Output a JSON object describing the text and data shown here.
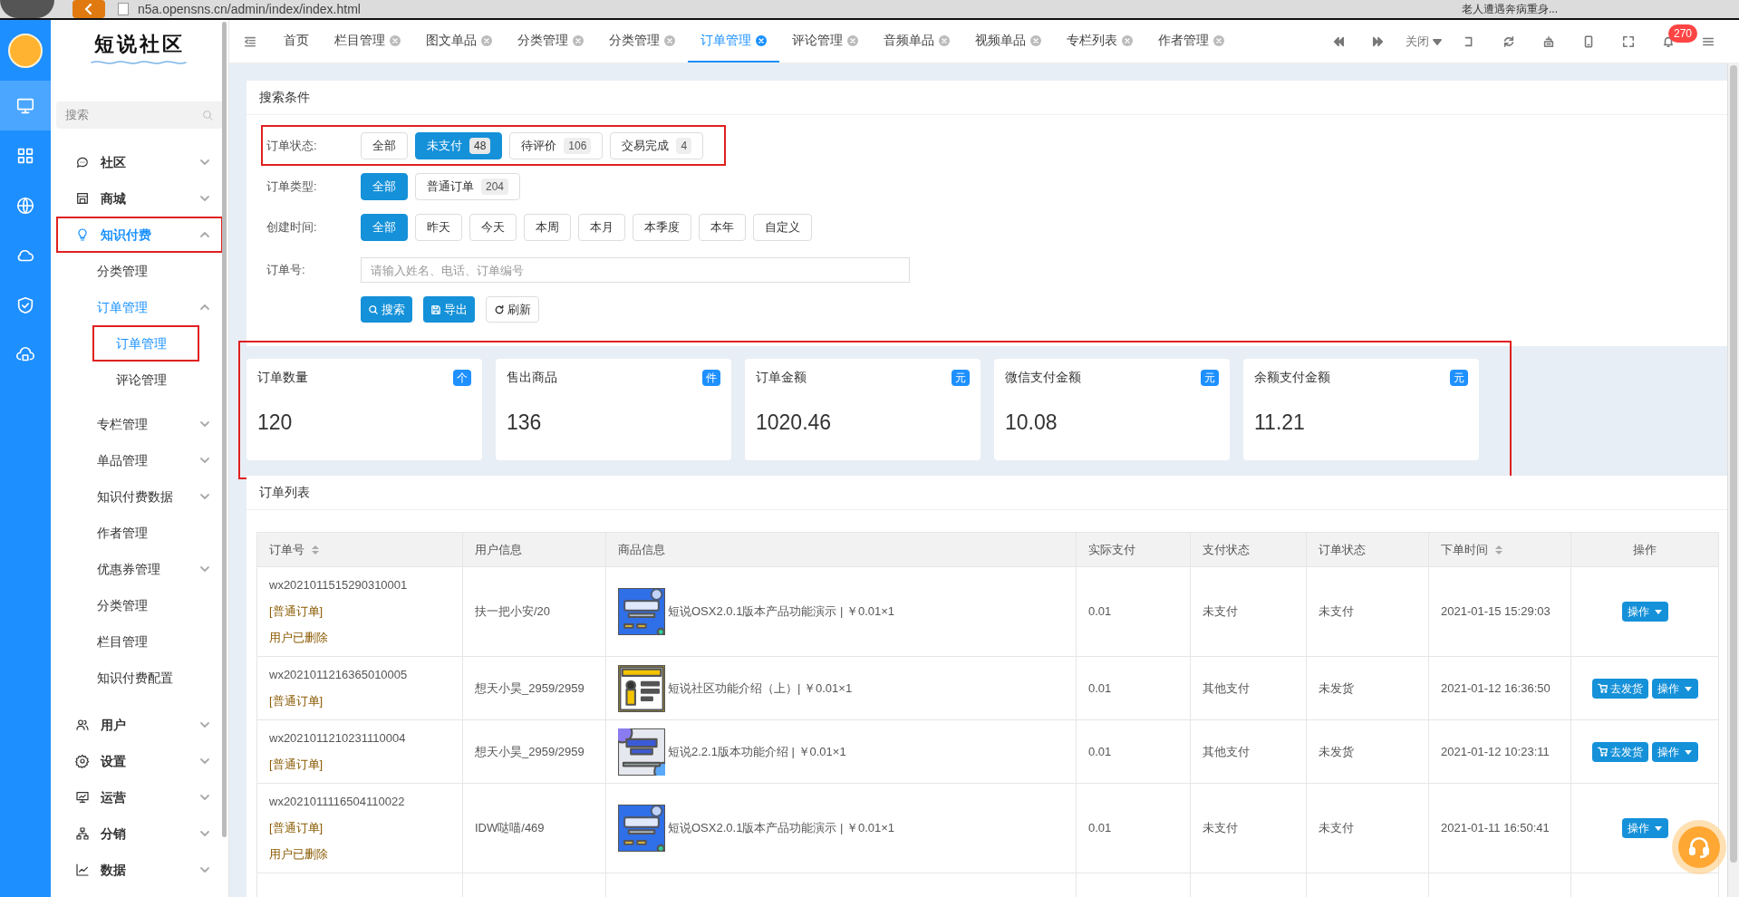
{
  "browser": {
    "url": "n5a.opensns.cn/admin/index/index.html",
    "news": "老人遭遇奔病重身..."
  },
  "rail": [
    {
      "selected": true
    },
    {
      "selected": false
    },
    {
      "selected": false
    },
    {
      "selected": false
    },
    {
      "selected": false
    },
    {
      "selected": false
    }
  ],
  "sidebar": {
    "logo": "短说社区",
    "search_placeholder": "搜索",
    "items": [
      {
        "label": "社区",
        "expanded": false,
        "selected": false,
        "marked": false
      },
      {
        "label": "商城",
        "expanded": false,
        "selected": false,
        "marked": false
      },
      {
        "label": "知识付费",
        "expanded": true,
        "selected": true,
        "marked": true,
        "children": [
          {
            "label": "分类管理",
            "selected": false,
            "marked": false
          },
          {
            "label": "订单管理",
            "expanded": true,
            "selected": true,
            "marked": false,
            "children": [
              {
                "label": "订单管理",
                "selected": true,
                "marked": true
              },
              {
                "label": "评论管理",
                "selected": false,
                "marked": false
              }
            ]
          },
          {
            "label": "专栏管理",
            "expanded": false,
            "selected": false,
            "marked": false
          },
          {
            "label": "单品管理",
            "expanded": false,
            "selected": false,
            "marked": false
          },
          {
            "label": "知识付费数据",
            "expanded": false,
            "selected": false,
            "marked": false
          },
          {
            "label": "作者管理",
            "selected": false,
            "marked": false
          },
          {
            "label": "优惠券管理",
            "expanded": false,
            "selected": false,
            "marked": false
          },
          {
            "label": "分类管理",
            "selected": false,
            "marked": false
          },
          {
            "label": "栏目管理",
            "selected": false,
            "marked": false
          },
          {
            "label": "知识付费配置",
            "selected": false,
            "marked": false
          }
        ]
      },
      {
        "label": "用户",
        "expanded": false,
        "selected": false,
        "marked": false
      },
      {
        "label": "设置",
        "expanded": false,
        "selected": false,
        "marked": false
      },
      {
        "label": "运营",
        "expanded": false,
        "selected": false,
        "marked": false
      },
      {
        "label": "分销",
        "expanded": false,
        "selected": false,
        "marked": false
      },
      {
        "label": "数据",
        "expanded": false,
        "selected": false,
        "marked": false
      }
    ]
  },
  "tabs": [
    {
      "label": "首页",
      "closable": false,
      "selected": false
    },
    {
      "label": "栏目管理",
      "closable": true,
      "selected": false
    },
    {
      "label": "图文单品",
      "closable": true,
      "selected": false
    },
    {
      "label": "分类管理",
      "closable": true,
      "selected": false
    },
    {
      "label": "分类管理",
      "closable": true,
      "selected": false
    },
    {
      "label": "订单管理",
      "closable": true,
      "selected": true
    },
    {
      "label": "评论管理",
      "closable": true,
      "selected": false
    },
    {
      "label": "音频单品",
      "closable": true,
      "selected": false
    },
    {
      "label": "视频单品",
      "closable": true,
      "selected": false
    },
    {
      "label": "专栏列表",
      "closable": true,
      "selected": false
    },
    {
      "label": "作者管理",
      "closable": true,
      "selected": false
    }
  ],
  "toolbar": {
    "close_menu": "关闭",
    "notifications": "270"
  },
  "search": {
    "title": "搜索条件",
    "filters": [
      {
        "label": "订单状态:",
        "marked": true,
        "options": [
          {
            "label": "全部",
            "selected": false
          },
          {
            "label": "未支付",
            "count": "48",
            "selected": true
          },
          {
            "label": "待评价",
            "count": "106",
            "selected": false
          },
          {
            "label": "交易完成",
            "count": "4",
            "selected": false
          }
        ]
      },
      {
        "label": "订单类型:",
        "marked": false,
        "options": [
          {
            "label": "全部",
            "selected": true
          },
          {
            "label": "普通订单",
            "count": "204",
            "selected": false
          }
        ]
      },
      {
        "label": "创建时间:",
        "marked": false,
        "options": [
          {
            "label": "全部",
            "selected": true
          },
          {
            "label": "昨天",
            "selected": false
          },
          {
            "label": "今天",
            "selected": false
          },
          {
            "label": "本周",
            "selected": false
          },
          {
            "label": "本月",
            "selected": false
          },
          {
            "label": "本季度",
            "selected": false
          },
          {
            "label": "本年",
            "selected": false
          },
          {
            "label": "自定义",
            "selected": false
          }
        ]
      }
    ],
    "order_no": {
      "label": "订单号:",
      "placeholder": "请输入姓名、电话、订单编号"
    },
    "buttons": [
      {
        "label": "搜索",
        "kind": "primary"
      },
      {
        "label": "导出",
        "kind": "primary"
      },
      {
        "label": "刷新",
        "kind": "default"
      }
    ]
  },
  "stats": {
    "marked": true,
    "cards": [
      {
        "label": "订单数量",
        "unit": "个",
        "value": "120"
      },
      {
        "label": "售出商品",
        "unit": "件",
        "value": "136"
      },
      {
        "label": "订单金额",
        "unit": "元",
        "value": "1020.46"
      },
      {
        "label": "微信支付金额",
        "unit": "元",
        "value": "10.08"
      },
      {
        "label": "余额支付金额",
        "unit": "元",
        "value": "11.21"
      }
    ]
  },
  "orders": {
    "title": "订单列表",
    "columns": [
      {
        "label": "订单号",
        "sortable": true
      },
      {
        "label": "用户信息",
        "sortable": false
      },
      {
        "label": "商品信息",
        "sortable": false
      },
      {
        "label": "实际支付",
        "sortable": false
      },
      {
        "label": "支付状态",
        "sortable": false
      },
      {
        "label": "订单状态",
        "sortable": false
      },
      {
        "label": "下单时间",
        "sortable": true
      },
      {
        "label": "操作",
        "sortable": false
      }
    ],
    "rows": [
      {
        "order_no": "wx2021011515290310001",
        "type": "[普通订单]",
        "note": "用户已删除",
        "user": "扶一把小安/20",
        "product": {
          "title": "短说OSX2.0.1版本产品功能演示 | ￥0.01×1"
        },
        "paid": "0.01",
        "pay_status": "未支付",
        "order_status": "未支付",
        "time": "2021-01-15 15:29:03",
        "actions": [
          {
            "label": "操作",
            "kind": "menu"
          }
        ]
      },
      {
        "order_no": "wx2021011216365010005",
        "type": "[普通订单]",
        "user": "想天小昊_2959/2959",
        "product": {
          "title": "短说社区功能介绍（上）| ￥0.01×1"
        },
        "paid": "0.01",
        "pay_status": "其他支付",
        "order_status": "未发货",
        "time": "2021-01-12 16:36:50",
        "actions": [
          {
            "label": "去发货",
            "kind": "ship"
          },
          {
            "label": "操作",
            "kind": "menu"
          }
        ]
      },
      {
        "order_no": "wx2021011210231110004",
        "type": "[普通订单]",
        "user": "想天小昊_2959/2959",
        "product": {
          "title": "短说2.2.1版本功能介绍 | ￥0.01×1"
        },
        "paid": "0.01",
        "pay_status": "其他支付",
        "order_status": "未发货",
        "time": "2021-01-12 10:23:11",
        "actions": [
          {
            "label": "去发货",
            "kind": "ship"
          },
          {
            "label": "操作",
            "kind": "menu"
          }
        ]
      },
      {
        "order_no": "wx2021011116504110022",
        "type": "[普通订单]",
        "note": "用户已删除",
        "user": "IDW哒喵/469",
        "product": {
          "title": "短说OSX2.0.1版本产品功能演示 | ￥0.01×1"
        },
        "paid": "0.01",
        "pay_status": "未支付",
        "order_status": "未支付",
        "time": "2021-01-11 16:50:41",
        "actions": [
          {
            "label": "操作",
            "kind": "menu"
          }
        ]
      }
    ]
  }
}
